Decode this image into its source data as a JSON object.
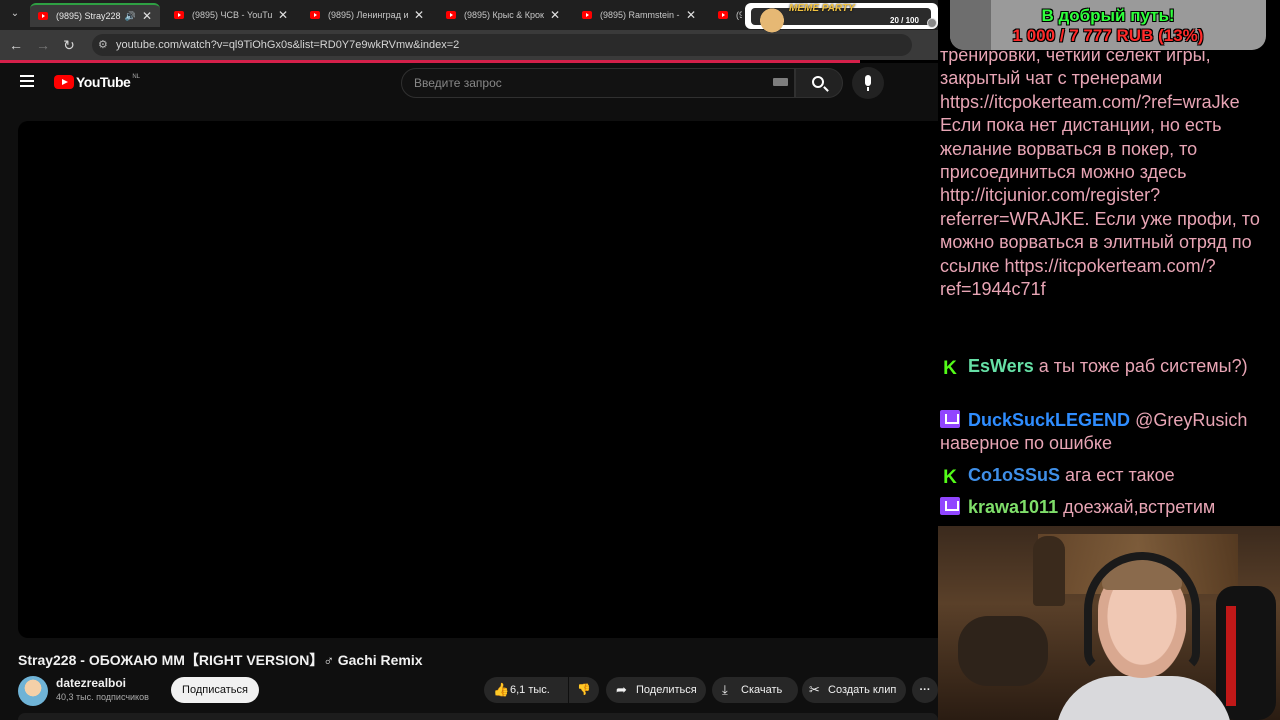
{
  "browser": {
    "tabs": [
      {
        "title": "(9895) Stray228 -",
        "active": true
      },
      {
        "title": "(9895) ЧСВ - YouTube"
      },
      {
        "title": "(9895) Ленинград и"
      },
      {
        "title": "(9895) Крыс & Крок"
      },
      {
        "title": "(9895) Rammstein - S"
      },
      {
        "title": "(9"
      }
    ],
    "url": "youtube.com/watch?v=ql9TiOhGx0s&list=RD0Y7e9wkRVmw&index=2",
    "accent_color": "#2ea043"
  },
  "overlay": {
    "meme_label": "MEME PARTY",
    "meme_count": "20 / 100"
  },
  "youtube": {
    "logo_text": "YouTube",
    "country_code": "NL",
    "search_placeholder": "Введите запрос",
    "video_title": "Stray228 - ОБОЖАЮ ММ【RIGHT VERSION】♂ Gachi Remix",
    "channel_name": "datezrealboi",
    "subscribers": "40,3 тыс. подписчиков",
    "subscribe_label": "Подписаться",
    "likes": "6,1 тыс.",
    "share_label": "Поделиться",
    "download_label": "Скачать",
    "clip_label": "Создать клип",
    "more_label": "···",
    "brand_color": "#ff0000"
  },
  "stream": {
    "donation_title": "В добрый путь!",
    "donation_progress": "1 000 / 7 777 RUB (13%)",
    "donation_fraction": 0.13,
    "chat_paragraph": "тренировки, четкий селект игры, закрытый чат с тренерами https://itcpokerteam.com/?ref=wraJke Если пока нет дистанции, но есть желание ворваться в покер, то присоединиться можно здесь http://itcjunior.com/register?referrer=WRAJKE. Если уже профи, то можно ворваться в элитный отряд по ссылке https://itcpokerteam.com/?ref=1944c71f",
    "messages": [
      {
        "platform": "kick",
        "user": "EsWers",
        "text": "а ты тоже раб системы?)"
      },
      {
        "platform": "twitch",
        "user": "DuckSuckLEGEND",
        "text": "@GreyRusich наверное по ошибке"
      },
      {
        "platform": "kick",
        "user": "Co1oSSuS",
        "text": "ага ест такое"
      },
      {
        "platform": "twitch",
        "user": "krawa1011",
        "text": "доезжай,встретим"
      }
    ]
  }
}
